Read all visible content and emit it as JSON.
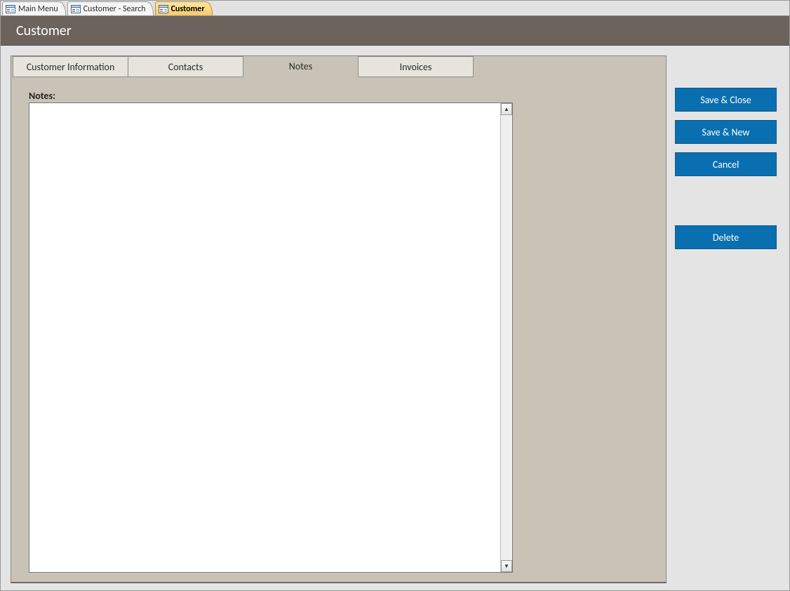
{
  "docTabs": [
    {
      "label": "Main Menu",
      "active": false
    },
    {
      "label": "Customer - Search",
      "active": false
    },
    {
      "label": "Customer",
      "active": true
    }
  ],
  "header": {
    "title": "Customer"
  },
  "innerTabs": [
    {
      "label": "Customer Information",
      "active": false
    },
    {
      "label": "Contacts",
      "active": false
    },
    {
      "label": "Notes",
      "active": true
    },
    {
      "label": "Invoices",
      "active": false
    }
  ],
  "notes": {
    "label": "Notes:",
    "value": ""
  },
  "buttons": {
    "saveClose": "Save & Close",
    "saveNew": "Save & New",
    "cancel": "Cancel",
    "delete": "Delete"
  }
}
